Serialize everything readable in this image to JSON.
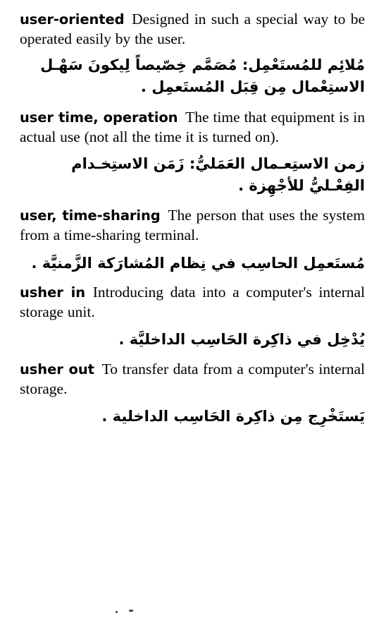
{
  "page": {
    "background_color": "#ffffff",
    "text_color": "#000000",
    "language_pair": "English-Arabic"
  },
  "entries": [
    {
      "headword": "user-oriented",
      "definition": "Designed in such a special way to be operated easily by the user.",
      "arabic": "مُلائِم للمُستَعْمِل: مُصَمَّم خِصّيصاً لِيكونَ سَهْـل الاستِعْمال مِن قِبَل المُستَعمِل ."
    },
    {
      "headword": "user time, operation",
      "definition": "The time that equipment is in actual use (not all the time it is turned on).",
      "arabic": "زمن الاستِعـمال العَمَليُّ: زَمَن الاستِخـدام الفِعْـليُّ للأجْهِزة ."
    },
    {
      "headword": "user, time-sharing",
      "definition": "The person that uses the system from a time-sharing terminal.",
      "arabic": "مُستَعمِل الحاسِب في نِظام المُشارَكة الزَّمنيَّة ."
    },
    {
      "headword": "usher in",
      "definition": "Introducing data into a computer's internal storage unit.",
      "arabic": "يُدْخِل في ذاكِرة الحَاسِب الداخليَّة ."
    },
    {
      "headword": "usher out",
      "definition": "To transfer data from a computer's internal storage.",
      "arabic": "يَستَخْرِج مِن ذاكِرة الحَاسِب الداخلية ."
    }
  ]
}
